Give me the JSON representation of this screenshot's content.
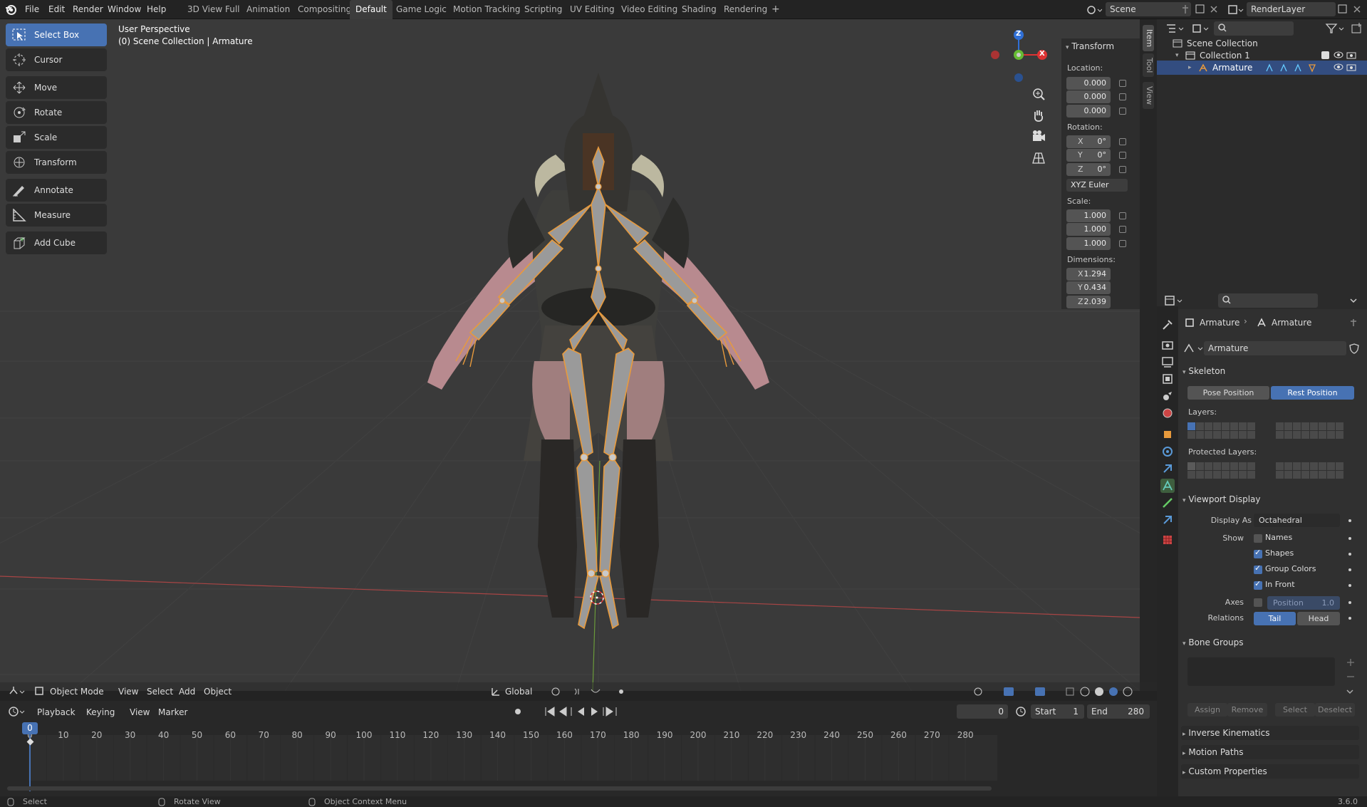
{
  "topbar": {
    "menus": [
      "File",
      "Edit",
      "Render",
      "Window",
      "Help"
    ],
    "workspaces": [
      "3D View Full",
      "Animation",
      "Compositing",
      "Default",
      "Game Logic",
      "Motion Tracking",
      "Scripting",
      "UV Editing",
      "Video Editing",
      "Shading",
      "Rendering"
    ],
    "add_tab": "+",
    "scene": "Scene",
    "render_layer": "RenderLayer"
  },
  "toolbar": {
    "items": [
      "Select Box",
      "Cursor",
      "Move",
      "Rotate",
      "Scale",
      "Transform",
      "Annotate",
      "Measure",
      "Add Cube"
    ]
  },
  "viewport": {
    "perspective": "User Perspective",
    "context": "(0) Scene Collection | Armature",
    "gizmo_z": "Z",
    "gizmo_x": "X"
  },
  "npanel": {
    "title": "Transform",
    "location_label": "Location:",
    "location": [
      "0.000",
      "0.000",
      "0.000"
    ],
    "rotation_label": "Rotation:",
    "rotation": [
      {
        "axis": "X",
        "value": "0°"
      },
      {
        "axis": "Y",
        "value": "0°"
      },
      {
        "axis": "Z",
        "value": "0°"
      }
    ],
    "rotation_mode": "XYZ Euler",
    "scale_label": "Scale:",
    "scale": [
      "1.000",
      "1.000",
      "1.000"
    ],
    "dimensions_label": "Dimensions:",
    "dimensions": [
      {
        "axis": "X",
        "value": "1.294"
      },
      {
        "axis": "Y",
        "value": "0.434"
      },
      {
        "axis": "Z",
        "value": "2.039"
      }
    ],
    "tabs": [
      "Item",
      "Tool",
      "View"
    ]
  },
  "viewport_header": {
    "mode": "Object Mode",
    "menus": [
      "View",
      "Select",
      "Add",
      "Object"
    ],
    "orientation": "Global"
  },
  "timeline": {
    "menus": [
      "Playback",
      "Keying",
      "View",
      "Marker"
    ],
    "current_frame": "0",
    "start_label": "Start",
    "start": "1",
    "end_label": "End",
    "end": "280",
    "ticks": [
      "0",
      "10",
      "20",
      "30",
      "40",
      "50",
      "60",
      "70",
      "80",
      "90",
      "100",
      "110",
      "120",
      "130",
      "140",
      "150",
      "160",
      "170",
      "180",
      "190",
      "200",
      "210",
      "220",
      "230",
      "240",
      "250",
      "260",
      "270",
      "280"
    ]
  },
  "status": {
    "select": "Select",
    "rotate": "Rotate View",
    "context": "Object Context Menu",
    "version": "3.6.0"
  },
  "outliner": {
    "rows": [
      "Scene Collection",
      "Collection 1",
      "Armature"
    ]
  },
  "properties": {
    "breadcrumb": [
      "Armature",
      "Armature"
    ],
    "data_name": "Armature",
    "skeleton": "Skeleton",
    "pose_position": "Pose Position",
    "rest_position": "Rest Position",
    "layers_label": "Layers:",
    "protected_label": "Protected Layers:",
    "viewport_display": "Viewport Display",
    "display_as_label": "Display As",
    "display_as": "Octahedral",
    "show_label": "Show",
    "names": "Names",
    "shapes": "Shapes",
    "group_colors": "Group Colors",
    "in_front": "In Front",
    "axes_label": "Axes",
    "axes_position": "Position",
    "axes_value": "1.0",
    "relations_label": "Relations",
    "tail": "Tail",
    "head": "Head",
    "bone_groups": "Bone Groups",
    "assign": "Assign",
    "remove": "Remove",
    "select": "Select",
    "deselect": "Deselect",
    "inverse_kinematics": "Inverse Kinematics",
    "motion_paths": "Motion Paths",
    "custom_properties": "Custom Properties"
  },
  "colors": {
    "accent": "#4772b3",
    "selected_row": "#334d80",
    "bone": "#e89a3c"
  }
}
